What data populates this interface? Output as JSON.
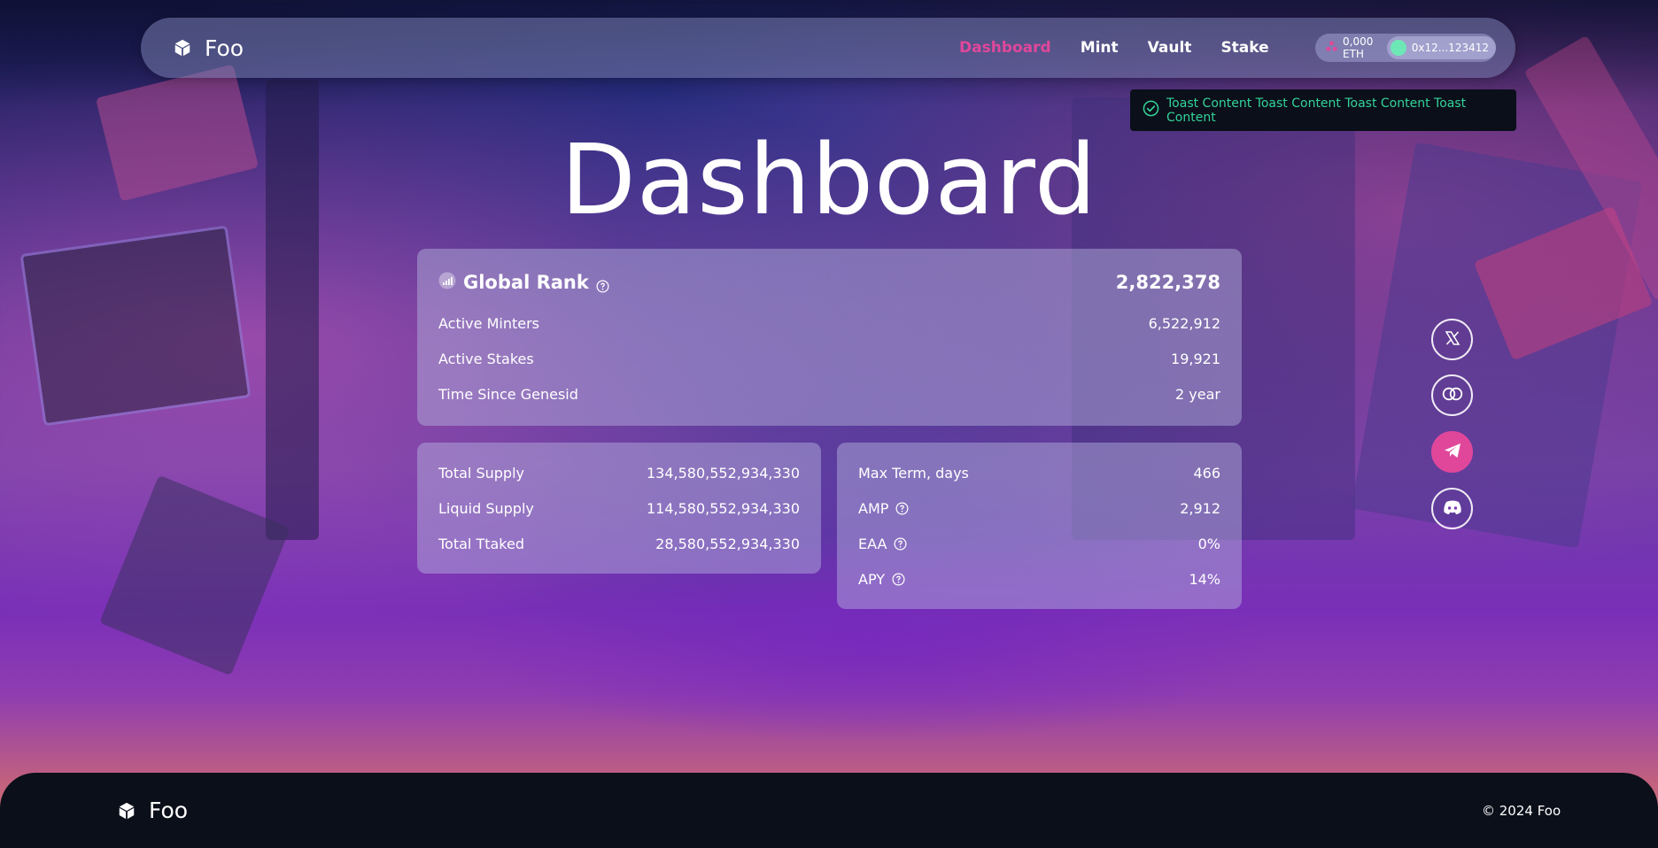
{
  "header": {
    "brand": "Foo",
    "nav": [
      {
        "label": "Dashboard",
        "active": true
      },
      {
        "label": "Mint",
        "active": false
      },
      {
        "label": "Vault",
        "active": false
      },
      {
        "label": "Stake",
        "active": false
      }
    ],
    "wallet": {
      "balance": "0,000 ETH",
      "address": "0x12...123412"
    }
  },
  "toast": {
    "message": "Toast Content Toast Content Toast Content Toast Content",
    "icon": "check-circle-icon",
    "color": "#34d399"
  },
  "page_title": "Dashboard",
  "global_stats": {
    "header": {
      "label": "Global Rank",
      "value": "2,822,378"
    },
    "rows": [
      {
        "label": "Active Minters",
        "value": "6,522,912"
      },
      {
        "label": "Active Stakes",
        "value": "19,921"
      },
      {
        "label": "Time Since Genesid",
        "value": "2 year"
      }
    ]
  },
  "supply_stats": {
    "rows": [
      {
        "label": "Total Supply",
        "value": "134,580,552,934,330"
      },
      {
        "label": "Liquid Supply",
        "value": "114,580,552,934,330"
      },
      {
        "label": "Total Ttaked",
        "value": "28,580,552,934,330"
      }
    ]
  },
  "term_stats": {
    "rows": [
      {
        "label": "Max Term, days",
        "value": "466",
        "help": false
      },
      {
        "label": "AMP",
        "value": "2,912",
        "help": true
      },
      {
        "label": "EAA",
        "value": "0%",
        "help": true
      },
      {
        "label": "APY",
        "value": "14%",
        "help": true
      }
    ]
  },
  "social": [
    {
      "name": "x-icon"
    },
    {
      "name": "link-icon"
    },
    {
      "name": "telegram-icon",
      "active": true
    },
    {
      "name": "discord-icon"
    }
  ],
  "footer": {
    "brand": "Foo",
    "copyright": "© 2024 Foo"
  },
  "colors": {
    "accent": "#e0479b",
    "success": "#34d399",
    "dark": "#0b0f1a"
  }
}
